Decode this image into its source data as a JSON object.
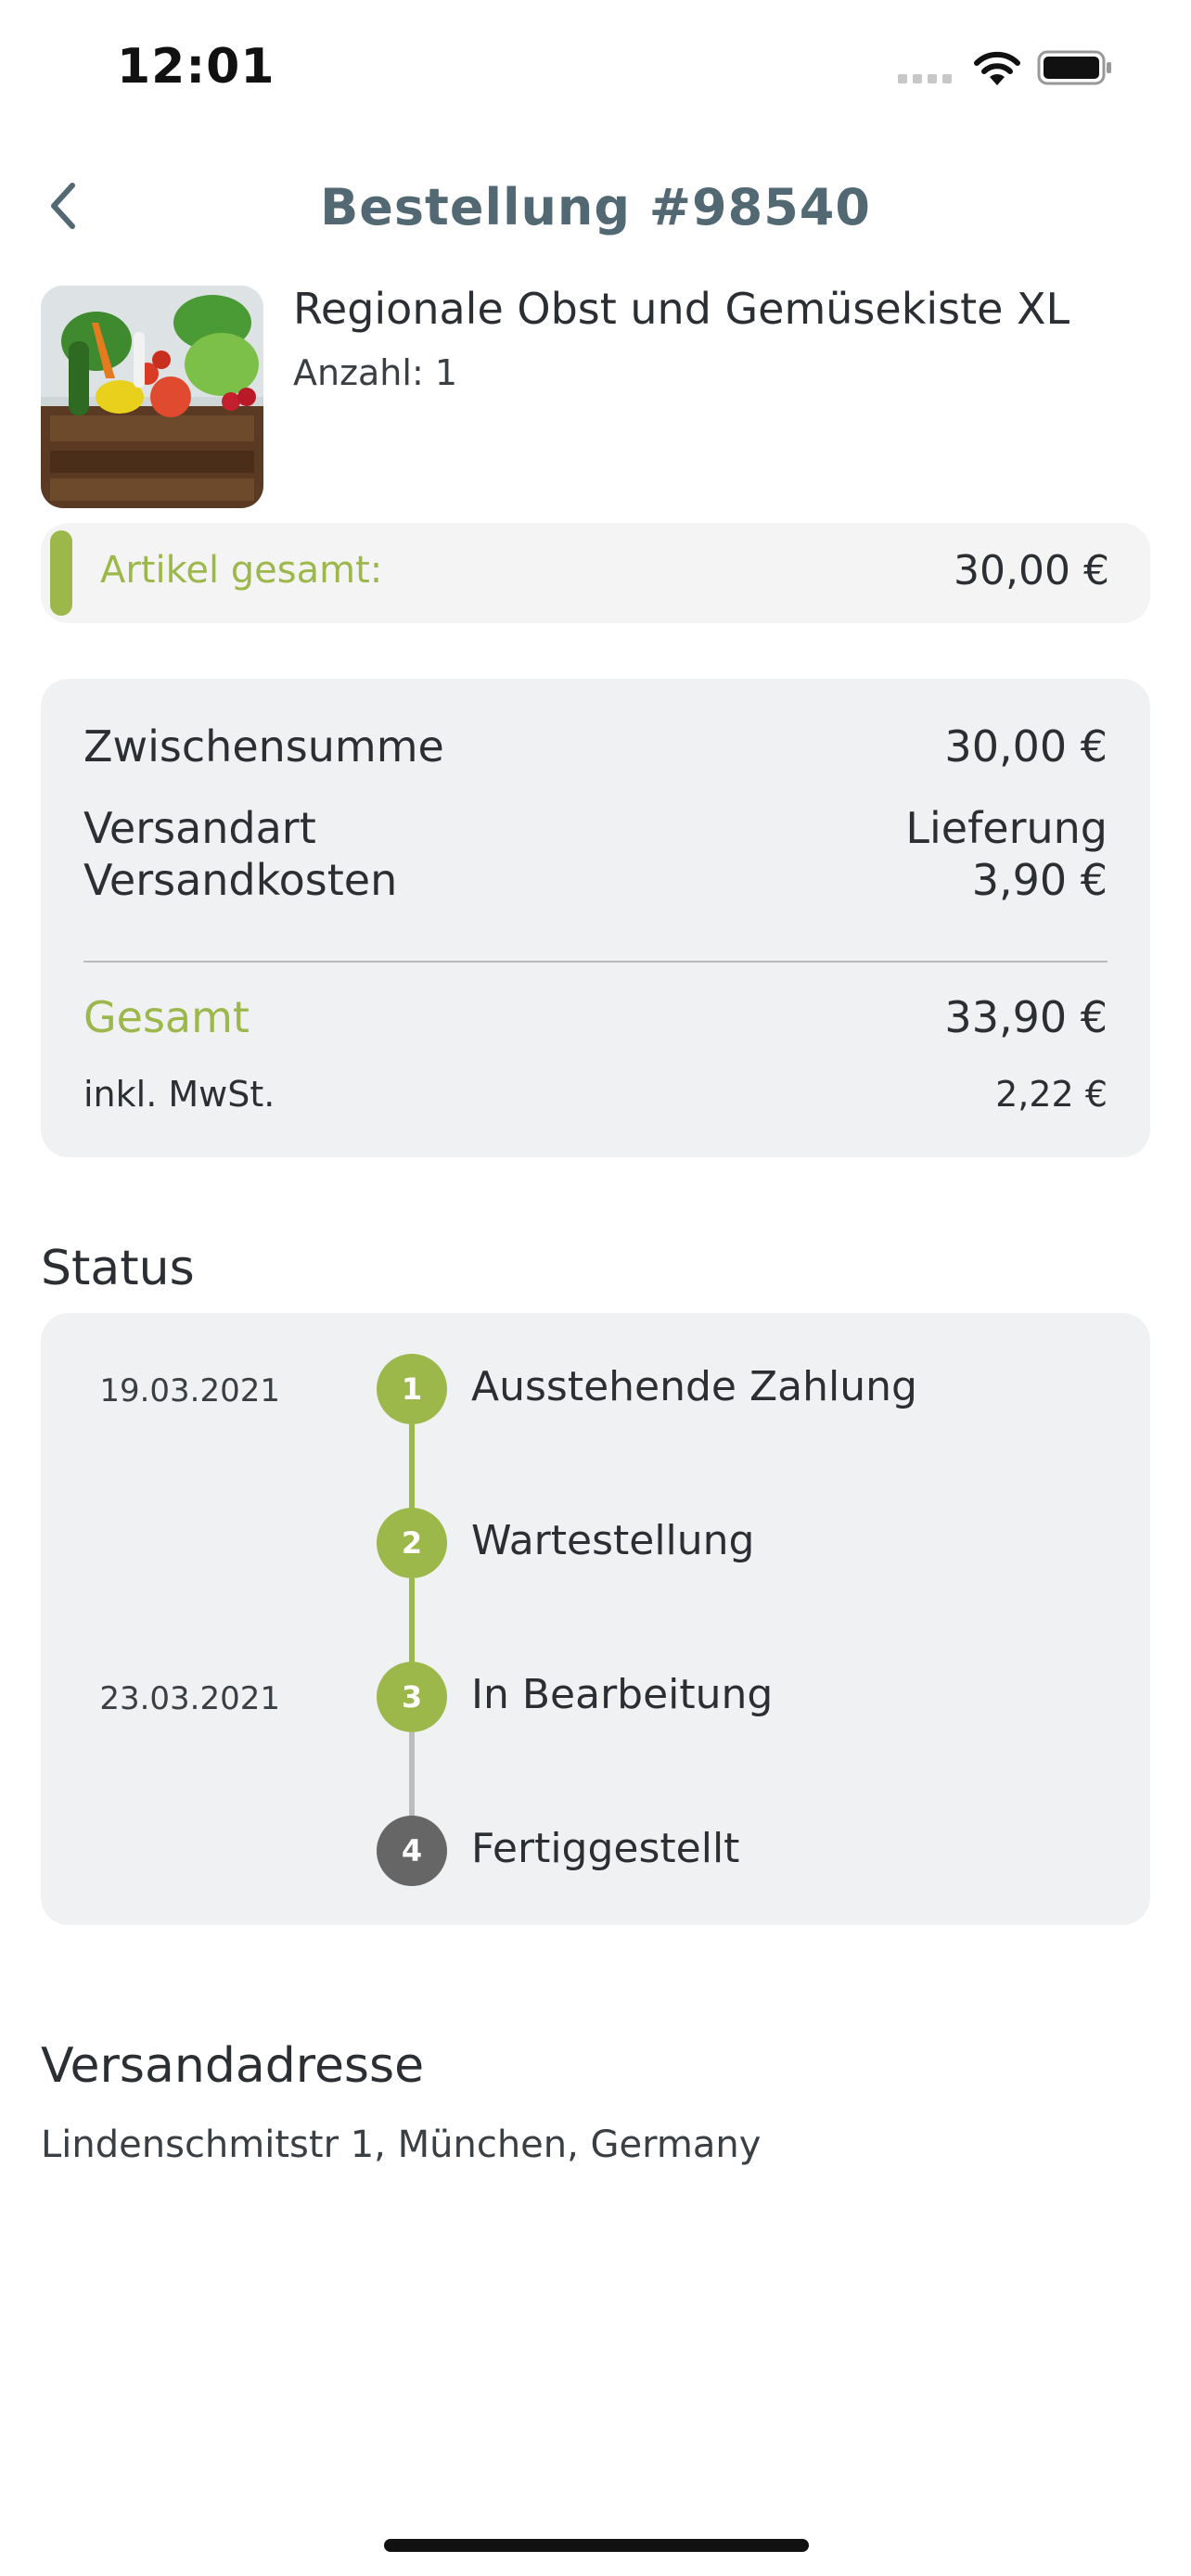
{
  "status_bar": {
    "time": "12:01"
  },
  "header": {
    "title": "Bestellung #98540",
    "back_icon": "chevron-left-icon"
  },
  "product": {
    "name": "Regionale Obst und Gemüsekiste XL",
    "quantity": "Anzahl: 1"
  },
  "article_total": {
    "label": "Artikel gesamt:",
    "value": "30,00 €"
  },
  "summary": {
    "subtotal_label": "Zwischensumme",
    "subtotal_value": "30,00 €",
    "shipping_method_label": "Versandart",
    "shipping_method_value": "Lieferung",
    "shipping_cost_label": "Versandkosten",
    "shipping_cost_value": "3,90 €",
    "total_label": "Gesamt",
    "total_value": "33,90 €",
    "vat_label": "inkl. MwSt.",
    "vat_value": "2,22 €"
  },
  "status": {
    "title": "Status",
    "steps": [
      {
        "number": "1",
        "label": "Ausstehende Zahlung",
        "date": "19.03.2021",
        "done": true
      },
      {
        "number": "2",
        "label": "Wartestellung",
        "date": "",
        "done": true
      },
      {
        "number": "3",
        "label": "In Bearbeitung",
        "date": "23.03.2021",
        "done": true
      },
      {
        "number": "4",
        "label": "Fertiggestellt",
        "date": "",
        "done": false
      }
    ]
  },
  "shipping_address": {
    "title": "Versandadresse",
    "address": "Lindenschmitstr 1, München, Germany"
  },
  "colors": {
    "accent": "#9cb84b",
    "title": "#526873",
    "pending": "#666666",
    "card_bg": "#f0f1f2"
  }
}
